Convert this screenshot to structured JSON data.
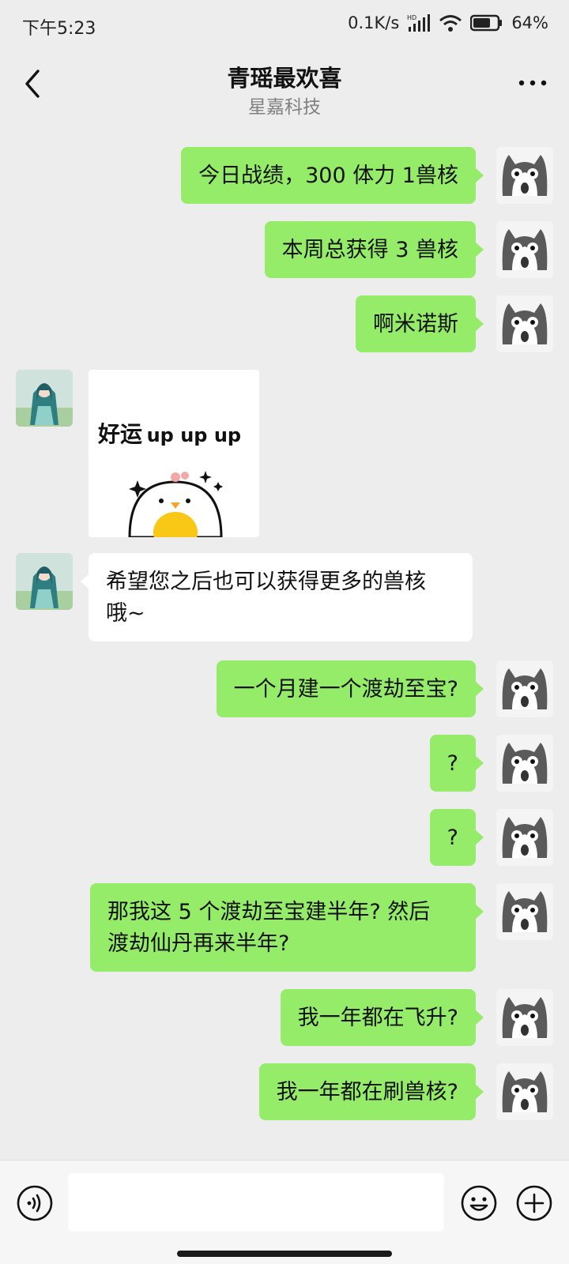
{
  "status_bar": {
    "time": "下午5:23",
    "network_speed": "0.1K/s",
    "network_type_icon": "hd-signal-icon",
    "wifi_icon": "wifi-icon",
    "battery_percent": "64%"
  },
  "header": {
    "title": "青瑶最欢喜",
    "subtitle": "星嘉科技"
  },
  "messages": [
    {
      "sender": "self",
      "type": "text",
      "text": "今日战绩，300 体力 1兽核"
    },
    {
      "sender": "self",
      "type": "text",
      "text": "本周总获得 3 兽核"
    },
    {
      "sender": "self",
      "type": "text",
      "text": "啊米诺斯"
    },
    {
      "sender": "other",
      "type": "sticker",
      "sticker_text_big": "好运",
      "sticker_text_small": "up up up"
    },
    {
      "sender": "other",
      "type": "text",
      "lines": [
        "希望您之后也可以获得更多的兽核",
        "哦~"
      ]
    },
    {
      "sender": "self",
      "type": "text",
      "text": "一个月建一个渡劫至宝?"
    },
    {
      "sender": "self",
      "type": "text",
      "text": "?"
    },
    {
      "sender": "self",
      "type": "text",
      "text": "?"
    },
    {
      "sender": "self",
      "type": "text",
      "lines": [
        "那我这 5 个渡劫至宝建半年? 然后",
        "渡劫仙丹再来半年?"
      ]
    },
    {
      "sender": "self",
      "type": "text",
      "text": "我一年都在飞升?"
    },
    {
      "sender": "self",
      "type": "text",
      "text": "我一年都在刷兽核?"
    }
  ],
  "input_bar": {
    "placeholder": "",
    "value": ""
  },
  "colors": {
    "background": "#ededed",
    "outgoing_bubble": "#95ec69",
    "incoming_bubble": "#ffffff"
  }
}
